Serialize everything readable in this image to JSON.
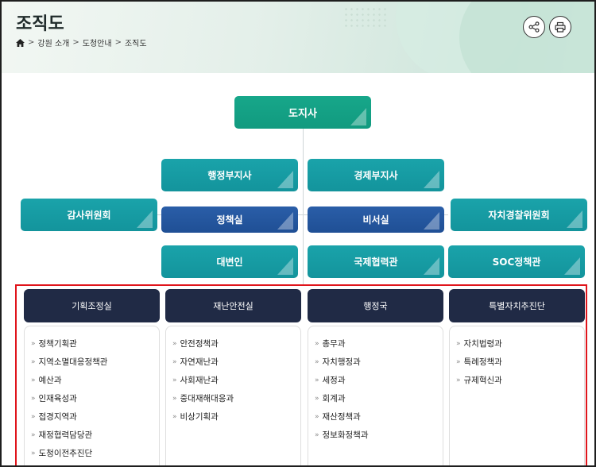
{
  "header": {
    "title": "조직도",
    "breadcrumb": [
      "강원 소개",
      "도청안내",
      "조직도"
    ]
  },
  "icons": {
    "home": "home-icon",
    "share": "share-icon",
    "print": "print-icon",
    "arrow": "double-chevron-right-icon"
  },
  "colors": {
    "teal": "#1aa3aa",
    "green": "#17a78a",
    "blue": "#2a5ea8",
    "navy": "#202a45",
    "highlight": "#e0141b"
  },
  "org": {
    "governor": "도지사",
    "vice_admin": "행정부지사",
    "vice_econ": "경제부지사",
    "audit": "감사위원회",
    "policy": "정책실",
    "secretary": "비서실",
    "police": "자치경찰위원회",
    "spokesperson": "대변인",
    "intl": "국제협력관",
    "soc": "SOC정책관"
  },
  "departments": [
    {
      "name": "기획조정실",
      "items": [
        "정책기획관",
        "지역소멸대응정책관",
        "예산과",
        "인재육성과",
        "접경지역과",
        "재정협력담당관",
        "도청이전추진단"
      ]
    },
    {
      "name": "재난안전실",
      "items": [
        "안전정책과",
        "자연재난과",
        "사회재난과",
        "중대재해대응과",
        "비상기획과"
      ]
    },
    {
      "name": "행정국",
      "items": [
        "총무과",
        "자치행정과",
        "세정과",
        "회계과",
        "재산정책과",
        "정보화정책과"
      ]
    },
    {
      "name": "특별자치추진단",
      "items": [
        "자치법령과",
        "특례정책과",
        "규제혁신과"
      ]
    }
  ]
}
